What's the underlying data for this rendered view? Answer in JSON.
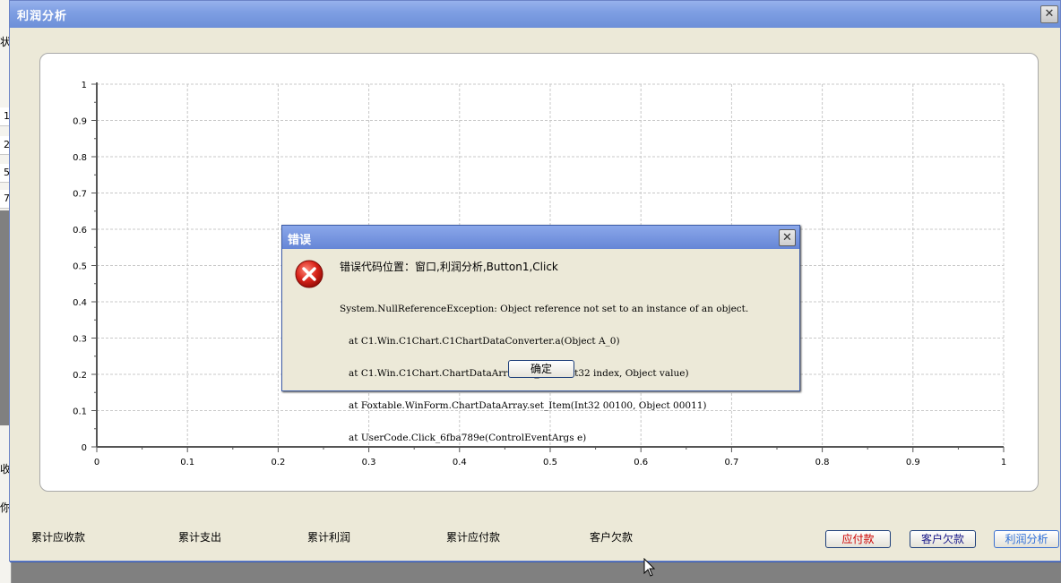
{
  "background_window": {
    "fragments": [
      "状",
      "1",
      "2",
      "5",
      "7",
      "收",
      "你"
    ]
  },
  "window": {
    "title": "利润分析",
    "close_glyph": "✕"
  },
  "chart_data": {
    "type": "line",
    "x_ticks": [
      "0",
      "0.1",
      "0.2",
      "0.3",
      "0.4",
      "0.5",
      "0.6",
      "0.7",
      "0.8",
      "0.9",
      "1"
    ],
    "y_ticks": [
      "0",
      "0.1",
      "0.2",
      "0.3",
      "0.4",
      "0.5",
      "0.6",
      "0.7",
      "0.8",
      "0.9",
      "1"
    ],
    "xlim": [
      0,
      1
    ],
    "ylim": [
      0,
      1
    ],
    "grid": true,
    "series": []
  },
  "summary_labels": [
    "累计应收款",
    "累计支出",
    "累计利润",
    "累计应付款",
    "客户欠款"
  ],
  "buttons": {
    "payable": "应付款",
    "customer_debt": "客户欠款",
    "profit_analysis": "利润分析"
  },
  "colors": {
    "payable_text": "#cc0000",
    "customer_debt_text": "#1a1a8a",
    "profit_text": "#2e6fd8"
  },
  "dialog": {
    "title": "错误",
    "close_glyph": "✕",
    "icon": "error-x-icon",
    "heading": "错误代码位置：窗口,利润分析,Button1,Click",
    "detail": [
      "System.NullReferenceException: Object reference not set to an instance of an object.",
      "   at C1.Win.C1Chart.C1ChartDataConverter.a(Object A_0)",
      "   at C1.Win.C1Chart.ChartDataArray.set_Item(Int32 index, Object value)",
      "   at Foxtable.WinForm.ChartDataArray.set_Item(Int32 00100, Object 00011)",
      "   at UserCode.Click_6fba789e(ControlEventArgs e)"
    ],
    "ok_label": "确定"
  }
}
